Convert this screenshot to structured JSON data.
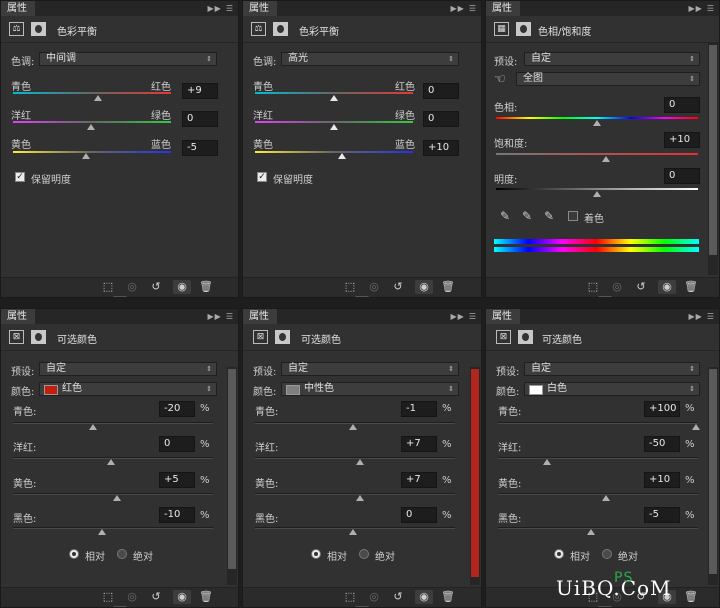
{
  "tab_label": "属性",
  "panel1": {
    "title": "色彩平衡",
    "tone_label": "色调:",
    "tone_value": "中间调",
    "rows": [
      {
        "left": "青色",
        "right": "红色",
        "value": "+9"
      },
      {
        "left": "洋红",
        "right": "绿色",
        "value": "0"
      },
      {
        "left": "黄色",
        "right": "蓝色",
        "value": "-5"
      }
    ],
    "preserve_label": "保留明度"
  },
  "panel2": {
    "title": "色彩平衡",
    "tone_label": "色调:",
    "tone_value": "高光",
    "rows": [
      {
        "left": "青色",
        "right": "红色",
        "value": "0"
      },
      {
        "left": "洋红",
        "right": "绿色",
        "value": "0"
      },
      {
        "left": "黄色",
        "right": "蓝色",
        "value": "+10"
      }
    ],
    "preserve_label": "保留明度"
  },
  "panel3": {
    "title": "色相/饱和度",
    "preset_label": "预设:",
    "preset_value": "自定",
    "channel_value": "全图",
    "hue_label": "色相:",
    "hue_value": "0",
    "sat_label": "饱和度:",
    "sat_value": "+10",
    "light_label": "明度:",
    "light_value": "0",
    "colorize_label": "着色"
  },
  "panel4": {
    "title": "可选颜色",
    "preset_label": "预设:",
    "preset_value": "自定",
    "color_label": "颜色:",
    "color_value": "红色",
    "swatch": "#c0200f",
    "rows": [
      {
        "label": "青色:",
        "value": "-20"
      },
      {
        "label": "洋红:",
        "value": "0"
      },
      {
        "label": "黄色:",
        "value": "+5"
      },
      {
        "label": "黑色:",
        "value": "-10"
      }
    ],
    "relative_label": "相对",
    "absolute_label": "绝对"
  },
  "panel5": {
    "title": "可选颜色",
    "preset_label": "预设:",
    "preset_value": "自定",
    "color_label": "颜色:",
    "color_value": "中性色",
    "swatch": "#7f7f7f",
    "rows": [
      {
        "label": "青色:",
        "value": "-1"
      },
      {
        "label": "洋红:",
        "value": "+7"
      },
      {
        "label": "黄色:",
        "value": "+7"
      },
      {
        "label": "黑色:",
        "value": "0"
      }
    ],
    "relative_label": "相对",
    "absolute_label": "绝对"
  },
  "panel6": {
    "title": "可选颜色",
    "preset_label": "预设:",
    "preset_value": "自定",
    "color_label": "颜色:",
    "color_value": "白色",
    "swatch": "#ffffff",
    "rows": [
      {
        "label": "青色:",
        "value": "+100"
      },
      {
        "label": "洋红:",
        "value": "-50"
      },
      {
        "label": "黄色:",
        "value": "+10"
      },
      {
        "label": "黑色:",
        "value": "-5"
      }
    ],
    "relative_label": "相对",
    "absolute_label": "绝对"
  },
  "percent": "%",
  "watermark": "UiBQ.CoM",
  "watermark_ps": "PS"
}
